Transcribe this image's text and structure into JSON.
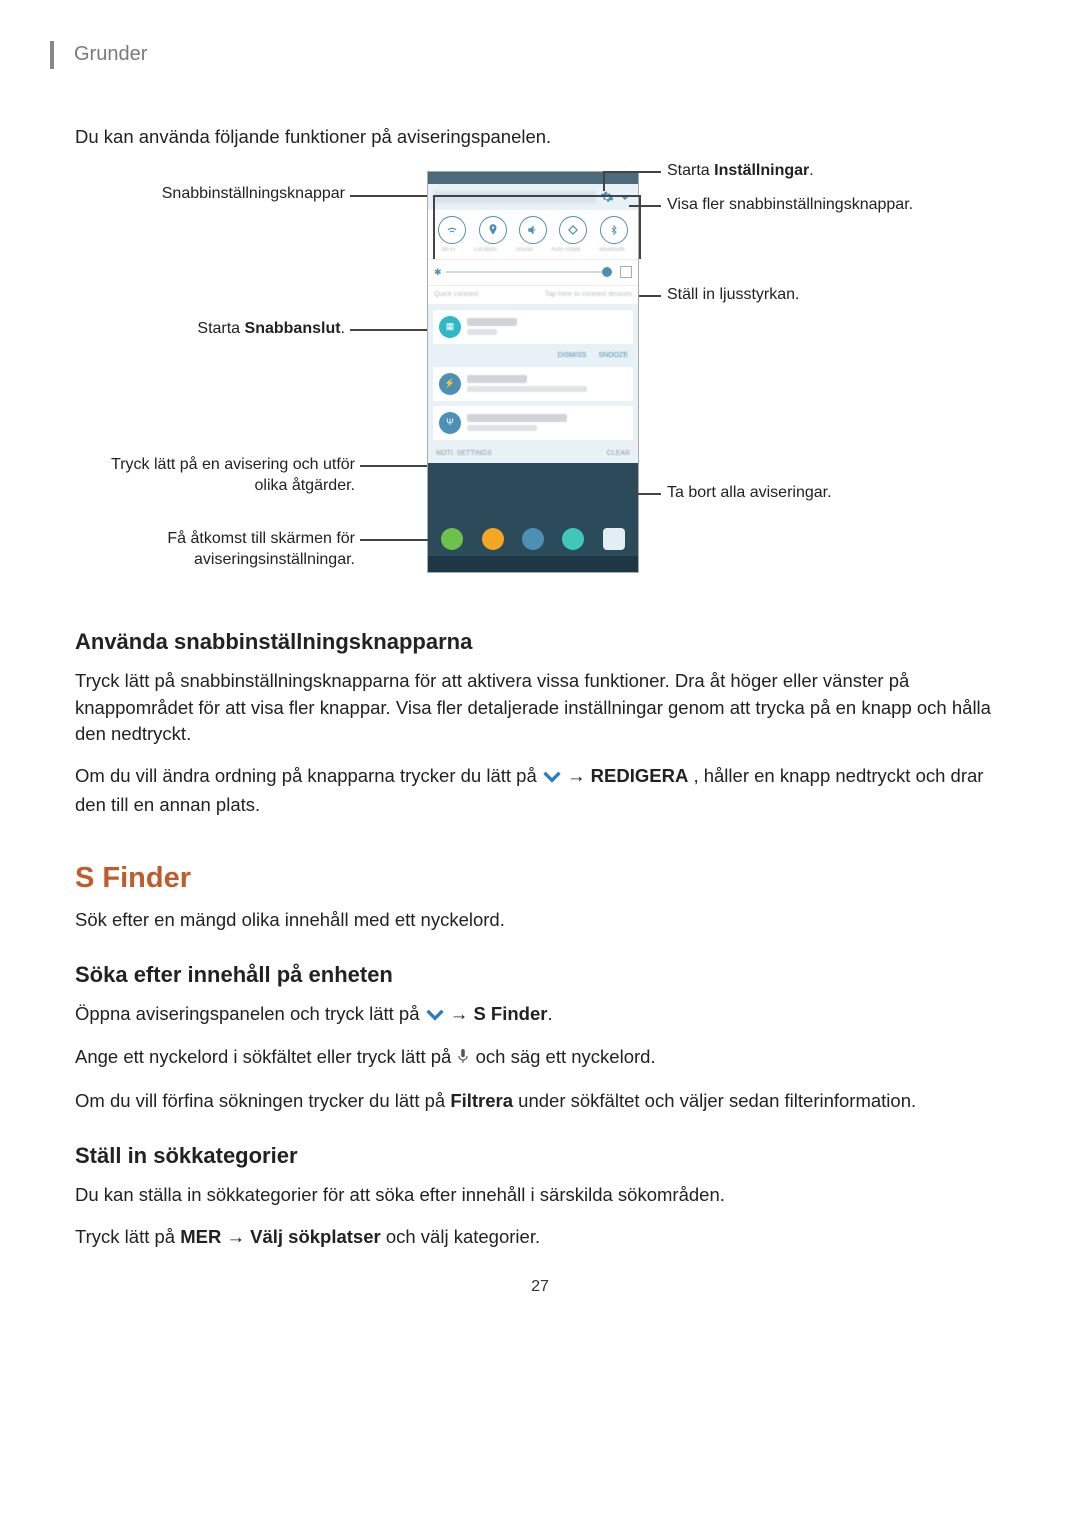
{
  "header": {
    "section": "Grunder"
  },
  "intro": "Du kan använda följande funktioner på aviseringspanelen.",
  "fig": {
    "left": {
      "quick_buttons": "Snabbinställningsknappar",
      "quick_connect_pre": "Starta ",
      "quick_connect_b": "Snabbanslut",
      "quick_connect_post": ".",
      "tap_notif": "Tryck lätt på en avisering och utför olika åtgärder.",
      "notif_settings": "Få åtkomst till skärmen för aviseringsinställningar."
    },
    "right": {
      "settings_pre": "Starta ",
      "settings_b": "Inställningar",
      "settings_post": ".",
      "more_qs": "Visa fler snabbinställningsknappar.",
      "brightness": "Ställ in ljusstyrkan.",
      "clear": "Ta bort alla aviseringar."
    }
  },
  "use_qs": {
    "title": "Använda snabbinställningsknapparna",
    "p1": "Tryck lätt på snabbinställningsknapparna för att aktivera vissa funktioner. Dra åt höger eller vänster på knappområdet för att visa fler knappar. Visa fler detaljerade inställningar genom att trycka på en knapp och hålla den nedtryckt.",
    "p2a": "Om du vill ändra ordning på knapparna trycker du lätt på ",
    "p2b": " → ",
    "p2c": "REDIGERA",
    "p2d": ", håller en knapp nedtryckt och drar den till en annan plats."
  },
  "sfinder": {
    "title": "S Finder",
    "intro": "Sök efter en mängd olika innehåll med ett nyckelord.",
    "search_title": "Söka efter innehåll på enheten",
    "s1a": "Öppna aviseringspanelen och tryck lätt på ",
    "s1b": " → ",
    "s1c": "S Finder",
    "s1d": ".",
    "s2a": "Ange ett nyckelord i sökfältet eller tryck lätt på ",
    "s2b": " och säg ett nyckelord.",
    "s3a": "Om du vill förfina sökningen trycker du lätt på ",
    "s3b": "Filtrera",
    "s3c": " under sökfältet och väljer sedan filterinformation.",
    "cat_title": "Ställ in sökkategorier",
    "cat_p": "Du kan ställa in sökkategorier för att söka efter innehåll i särskilda sökområden.",
    "cat2a": "Tryck lätt på ",
    "cat2b": "MER",
    "cat2c": " → ",
    "cat2d": "Välj sökplatser",
    "cat2e": " och välj kategorier."
  },
  "page": "27"
}
